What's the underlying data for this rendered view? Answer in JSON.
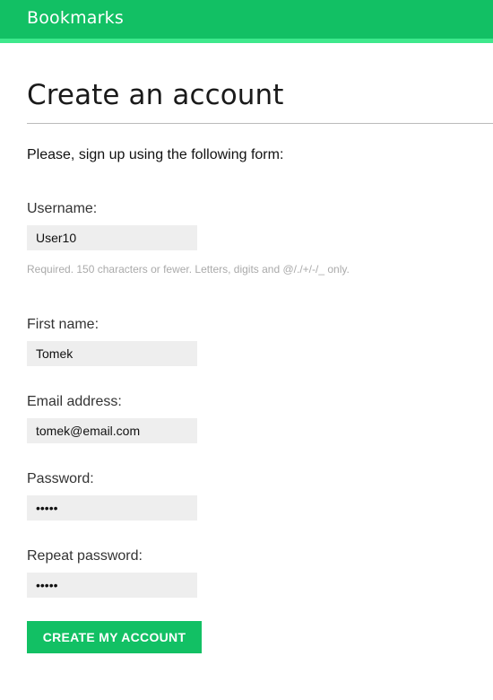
{
  "header": {
    "site_title": "Bookmarks",
    "brand_color": "#12c064",
    "accent_stripe_color": "#3ee88c"
  },
  "page": {
    "title": "Create an account",
    "intro": "Please, sign up using the following form:"
  },
  "form": {
    "username": {
      "label": "Username:",
      "value": "User10",
      "help": "Required. 150 characters or fewer. Letters, digits and @/./+/-/_ only."
    },
    "first_name": {
      "label": "First name:",
      "value": "Tomek"
    },
    "email": {
      "label": "Email address:",
      "value": "tomek@email.com"
    },
    "password": {
      "label": "Password:",
      "value": "•••••"
    },
    "password2": {
      "label": "Repeat password:",
      "value": "•••••"
    },
    "submit_label": "CREATE MY ACCOUNT"
  }
}
